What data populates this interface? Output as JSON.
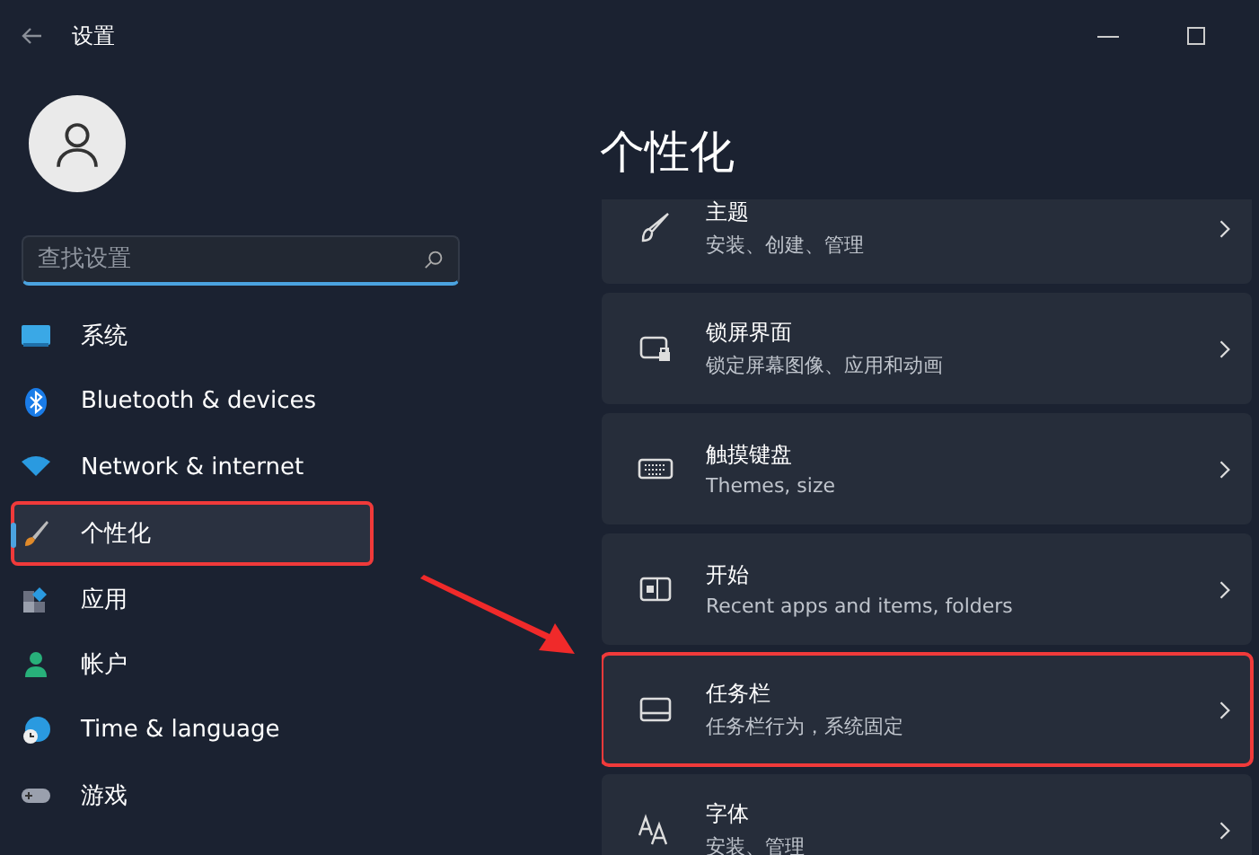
{
  "window": {
    "title": "设置"
  },
  "search": {
    "placeholder": "查找设置"
  },
  "sidebar": {
    "items": [
      {
        "label": "系统",
        "kind": "display",
        "selected": false,
        "highlighted": false
      },
      {
        "label": "Bluetooth & devices",
        "kind": "bluetooth",
        "selected": false,
        "highlighted": false
      },
      {
        "label": "Network & internet",
        "kind": "wifi",
        "selected": false,
        "highlighted": false
      },
      {
        "label": "个性化",
        "kind": "brush",
        "selected": true,
        "highlighted": true
      },
      {
        "label": "应用",
        "kind": "apps",
        "selected": false,
        "highlighted": false
      },
      {
        "label": "帐户",
        "kind": "person",
        "selected": false,
        "highlighted": false
      },
      {
        "label": "Time & language",
        "kind": "globe",
        "selected": false,
        "highlighted": false
      },
      {
        "label": "游戏",
        "kind": "gamepad",
        "selected": false,
        "highlighted": false
      }
    ]
  },
  "page": {
    "title": "个性化"
  },
  "cards": [
    {
      "title": "主题",
      "subtitle": "安装、创建、管理",
      "kind": "brush",
      "highlighted": false
    },
    {
      "title": "锁屏界面",
      "subtitle": "锁定屏幕图像、应用和动画",
      "kind": "lock",
      "highlighted": false
    },
    {
      "title": "触摸键盘",
      "subtitle": "Themes, size",
      "kind": "keyboard",
      "highlighted": false
    },
    {
      "title": "开始",
      "subtitle": "Recent apps and items, folders",
      "kind": "start",
      "highlighted": false
    },
    {
      "title": "任务栏",
      "subtitle": "任务栏行为，系统固定",
      "kind": "taskbar",
      "highlighted": true
    },
    {
      "title": "字体",
      "subtitle": "安装、管理",
      "kind": "font",
      "highlighted": false
    }
  ]
}
